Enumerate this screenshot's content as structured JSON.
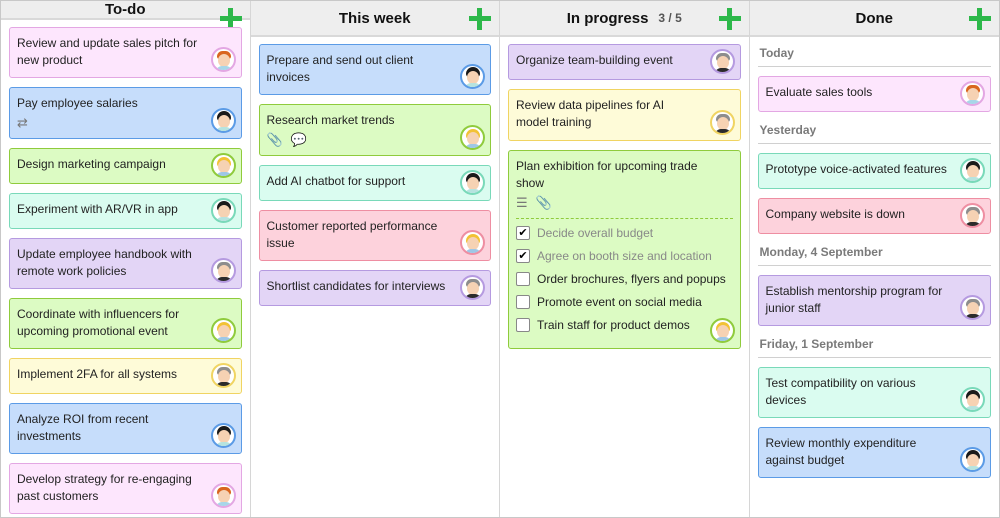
{
  "columns": [
    {
      "title": "To-do",
      "count": "",
      "add_label": "+",
      "cards": [
        {
          "text": "Review and update sales pitch for new product",
          "color": "pink",
          "avatar": "red",
          "icons": []
        },
        {
          "text": "Pay employee salaries",
          "color": "blue",
          "avatar": "dark",
          "icons": [
            "repeat-icon"
          ]
        },
        {
          "text": "Design marketing campaign",
          "color": "green",
          "avatar": "blond",
          "icons": []
        },
        {
          "text": "Experiment with AR/VR in app",
          "color": "mint",
          "avatar": "dark",
          "icons": []
        },
        {
          "text": "Update employee handbook with remote work policies",
          "color": "purple",
          "avatar": "gray",
          "icons": []
        },
        {
          "text": "Coordinate with influencers for upcoming promotional event",
          "color": "green",
          "avatar": "blond",
          "icons": []
        },
        {
          "text": "Implement 2FA for all systems",
          "color": "yellow",
          "avatar": "gray",
          "icons": []
        },
        {
          "text": "Analyze ROI from recent investments",
          "color": "blue",
          "avatar": "dark",
          "icons": []
        },
        {
          "text": "Develop strategy for re-engaging past customers",
          "color": "pink",
          "avatar": "red",
          "icons": []
        }
      ]
    },
    {
      "title": "This week",
      "count": "",
      "add_label": "+",
      "cards": [
        {
          "text": "Prepare and send out client invoices",
          "color": "blue",
          "avatar": "dark",
          "icons": []
        },
        {
          "text": "Research market trends",
          "color": "green",
          "avatar": "blond",
          "icons": [
            "paperclip-icon",
            "comment-icon"
          ]
        },
        {
          "text": "Add AI chatbot for support",
          "color": "mint",
          "avatar": "dark",
          "icons": []
        },
        {
          "text": "Customer reported performance issue",
          "color": "red",
          "avatar": "blond",
          "icons": []
        },
        {
          "text": "Shortlist candidates for interviews",
          "color": "purple",
          "avatar": "gray",
          "icons": []
        }
      ]
    },
    {
      "title": "In progress",
      "count": "3 / 5",
      "add_label": "+",
      "cards": [
        {
          "text": "Organize team-building event",
          "color": "purple",
          "avatar": "gray",
          "icons": []
        },
        {
          "text": "Review data pipelines for AI model training",
          "color": "yellow",
          "avatar": "gray",
          "icons": [],
          "tall": true
        },
        {
          "text": "Plan exhibition for upcoming trade show",
          "color": "green",
          "avatar": "blond",
          "icons": [
            "checklist-icon",
            "paperclip-icon"
          ],
          "checklist": [
            {
              "label": "Decide overall budget",
              "done": true
            },
            {
              "label": "Agree on booth size and location",
              "done": true
            },
            {
              "label": "Order brochures, flyers and popups",
              "done": false
            },
            {
              "label": "Promote event on social media",
              "done": false
            },
            {
              "label": "Train staff for product demos",
              "done": false
            }
          ]
        }
      ]
    },
    {
      "title": "Done",
      "count": "",
      "add_label": "+",
      "groups": [
        {
          "label": "Today",
          "cards": [
            {
              "text": "Evaluate sales tools",
              "color": "pink",
              "avatar": "red",
              "icons": []
            }
          ]
        },
        {
          "label": "Yesterday",
          "cards": [
            {
              "text": "Prototype voice-activated features",
              "color": "mint",
              "avatar": "dark",
              "icons": []
            },
            {
              "text": "Company website is down",
              "color": "red",
              "avatar": "gray",
              "icons": []
            }
          ]
        },
        {
          "label": "Monday, 4 September",
          "cards": [
            {
              "text": "Establish mentorship program for junior staff",
              "color": "purple",
              "avatar": "gray",
              "icons": []
            }
          ]
        },
        {
          "label": "Friday, 1 September",
          "cards": [
            {
              "text": "Test compatibility on various devices",
              "color": "mint",
              "avatar": "dark",
              "icons": []
            },
            {
              "text": "Review monthly expenditure against budget",
              "color": "blue",
              "avatar": "dark",
              "icons": []
            }
          ]
        }
      ]
    }
  ],
  "icon_glyphs": {
    "repeat-icon": "⇄",
    "paperclip-icon": "📎",
    "comment-icon": "💬",
    "checklist-icon": "☰",
    "check-mark": "✔"
  },
  "colors": {
    "add_button": "#2db84a",
    "pink": "#fde6fd",
    "blue": "#c6ddfb",
    "green": "#dcfbc3",
    "mint": "#dafcf0",
    "purple": "#e3d5f6",
    "yellow": "#fefbd8",
    "red": "#fdd2dc"
  }
}
